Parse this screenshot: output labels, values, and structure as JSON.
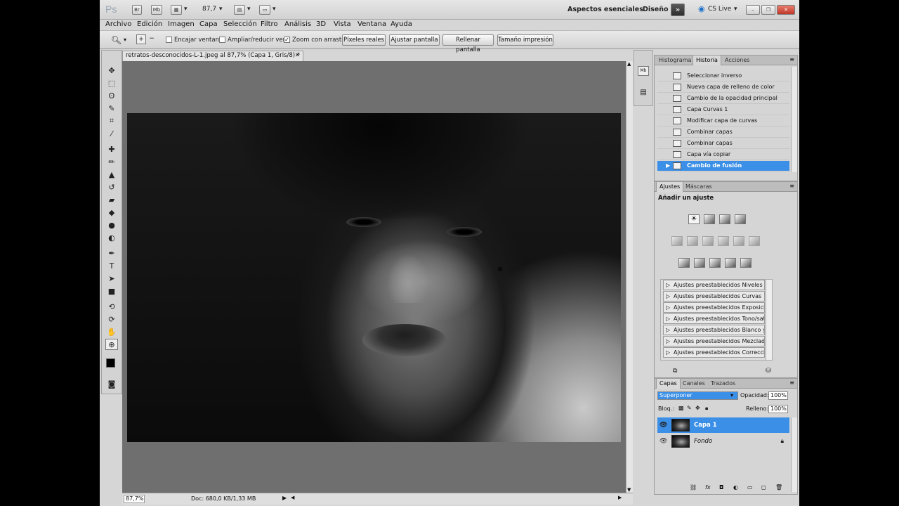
{
  "app": {
    "logo": "Ps",
    "zoom_value": "87,7",
    "workspace": "Aspectos esenciales",
    "design": "Diseño",
    "cslive": "CS Live"
  },
  "menu": [
    "Archivo",
    "Edición",
    "Imagen",
    "Capa",
    "Selección",
    "Filtro",
    "Análisis",
    "3D",
    "Vista",
    "Ventana",
    "Ayuda"
  ],
  "options": {
    "fit_window": "Encajar ventana",
    "resize": "Ampliar/reducir vent.",
    "scrubby": "Zoom con arrastre",
    "actual_pixels": "Píxeles reales",
    "fit_screen": "Ajustar pantalla",
    "fill_screen": "Rellenar pantalla",
    "print_size": "Tamaño impresión"
  },
  "document": {
    "tab_title": "retratos-desconocidos-L-1.jpeg al 87,7% (Capa 1, Gris/8) *",
    "zoom": "87,7%",
    "doc_info": "Doc: 680,0 KB/1,33 MB"
  },
  "history": {
    "tabs": [
      "Histograma",
      "Historia",
      "Acciones"
    ],
    "items": [
      "Seleccionar inverso",
      "Nueva capa de relleno de color",
      "Cambio de la opacidad principal",
      "Capa Curvas 1",
      "Modificar capa de curvas",
      "Combinar capas",
      "Combinar capas",
      "Capa vía copiar",
      "Cambio de fusión"
    ]
  },
  "adjustments": {
    "tabs": [
      "Ajustes",
      "Máscaras"
    ],
    "title": "Añadir un ajuste",
    "presets": [
      "Ajustes preestablecidos Niveles",
      "Ajustes preestablecidos Curvas",
      "Ajustes preestablecidos Exposición",
      "Ajustes preestablecidos Tono/satur...",
      "Ajustes preestablecidos Blanco y ne...",
      "Ajustes preestablecidos Mezclador ...",
      "Ajustes preestablecidos Corrección ..."
    ]
  },
  "layers": {
    "tabs": [
      "Capas",
      "Canales",
      "Trazados"
    ],
    "blend_mode": "Superponer",
    "opacity_label": "Opacidad:",
    "opacity": "100%",
    "lock_label": "Bloq.:",
    "fill_label": "Relleno:",
    "fill": "100%",
    "items": [
      "Capa 1",
      "Fondo"
    ]
  },
  "colors": {
    "accent": "#3b8fe6"
  }
}
